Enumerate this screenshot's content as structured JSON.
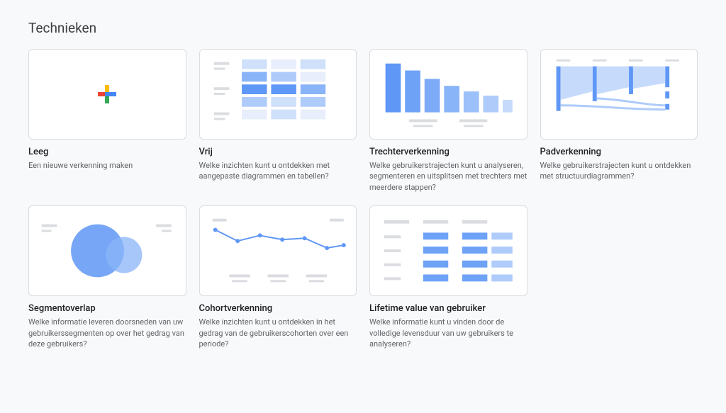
{
  "section_title": "Technieken",
  "cards": [
    {
      "title": "Leeg",
      "desc": "Een nieuwe verkenning maken"
    },
    {
      "title": "Vrij",
      "desc": "Welke inzichten kunt u ontdekken met aangepaste diagrammen en tabellen?"
    },
    {
      "title": "Trechterverkenning",
      "desc": "Welke gebruikerstrajecten kunt u analyseren, segmenteren en uitsplitsen met trechters met meerdere stappen?"
    },
    {
      "title": "Padverkenning",
      "desc": "Welke gebruikerstrajecten kunt u ontdekken met structuurdiagrammen?"
    },
    {
      "title": "Segmentoverlap",
      "desc": "Welke informatie leveren doorsneden van uw gebruikerssegmenten op over het gedrag van deze gebruikers?"
    },
    {
      "title": "Cohortverkenning",
      "desc": "Welke inzichten kunt u ontdekken in het gedrag van de gebruikerscohorten over een periode?"
    },
    {
      "title": "Lifetime value van gebruiker",
      "desc": "Welke informatie kunt u vinden door de volledige levensduur van uw gebruikers te analyseren?"
    }
  ]
}
